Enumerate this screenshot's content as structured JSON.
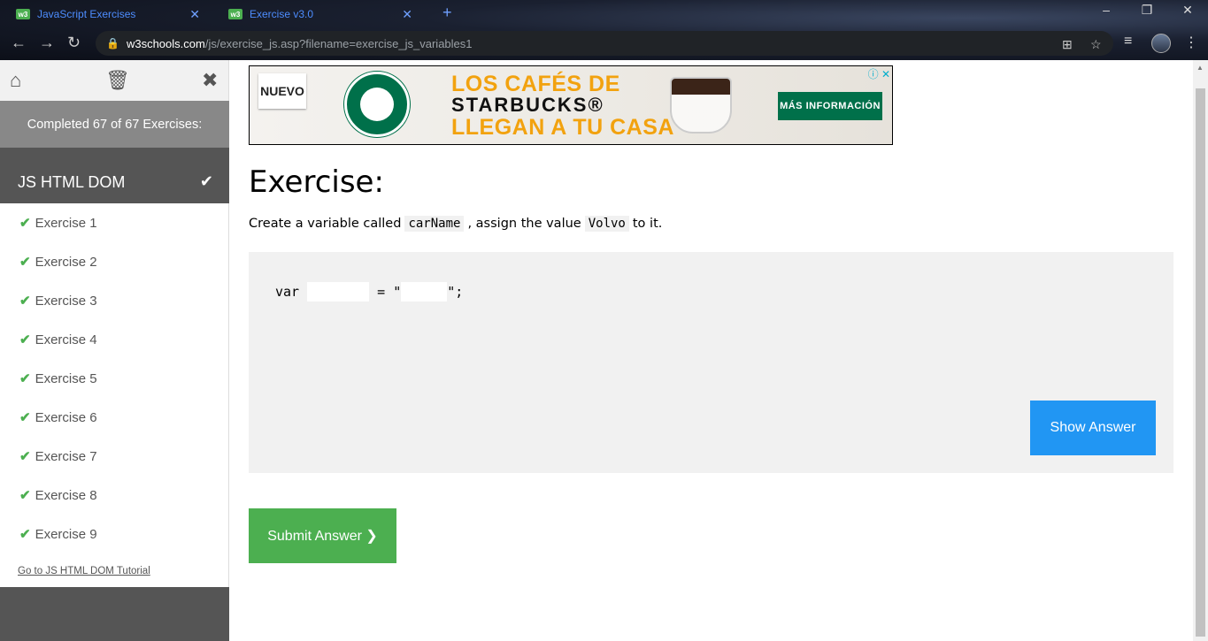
{
  "browser": {
    "tabs": [
      {
        "label": "JavaScript Exercises",
        "favicon": "w3"
      },
      {
        "label": "Exercise v3.0",
        "favicon": "w3"
      }
    ],
    "url_host": "w3schools.com",
    "url_path": "/js/exercise_js.asp?filename=exercise_js_variables1"
  },
  "sidebar": {
    "completed": "Completed 67 of 67 Exercises:",
    "section_title": "JS HTML DOM",
    "exercises": [
      "Exercise 1",
      "Exercise 2",
      "Exercise 3",
      "Exercise 4",
      "Exercise 5",
      "Exercise 6",
      "Exercise 7",
      "Exercise 8",
      "Exercise 9"
    ],
    "tutorial_link": "Go to JS HTML DOM Tutorial"
  },
  "ad": {
    "badge": "NUEVO",
    "line1": "LOS CAFÉS DE",
    "line2": "STARBUCKS®",
    "line3": "LLEGAN A TU CASA",
    "cta": "MÁS INFORMACIÓN"
  },
  "exercise": {
    "title": "Exercise:",
    "prompt_pre": "Create a variable called",
    "code1": "carName",
    "prompt_mid": ", assign the value",
    "code2": "Volvo",
    "prompt_post": "to it.",
    "code_var": "var",
    "code_eq": "= \"",
    "code_end": "\";",
    "input1_value": "",
    "input2_value": "",
    "show_answer": "Show Answer",
    "submit": "Submit Answer ❯"
  },
  "colors": {
    "green": "#4caf50",
    "blue": "#2196f3",
    "sidebar_dark": "#555555"
  }
}
